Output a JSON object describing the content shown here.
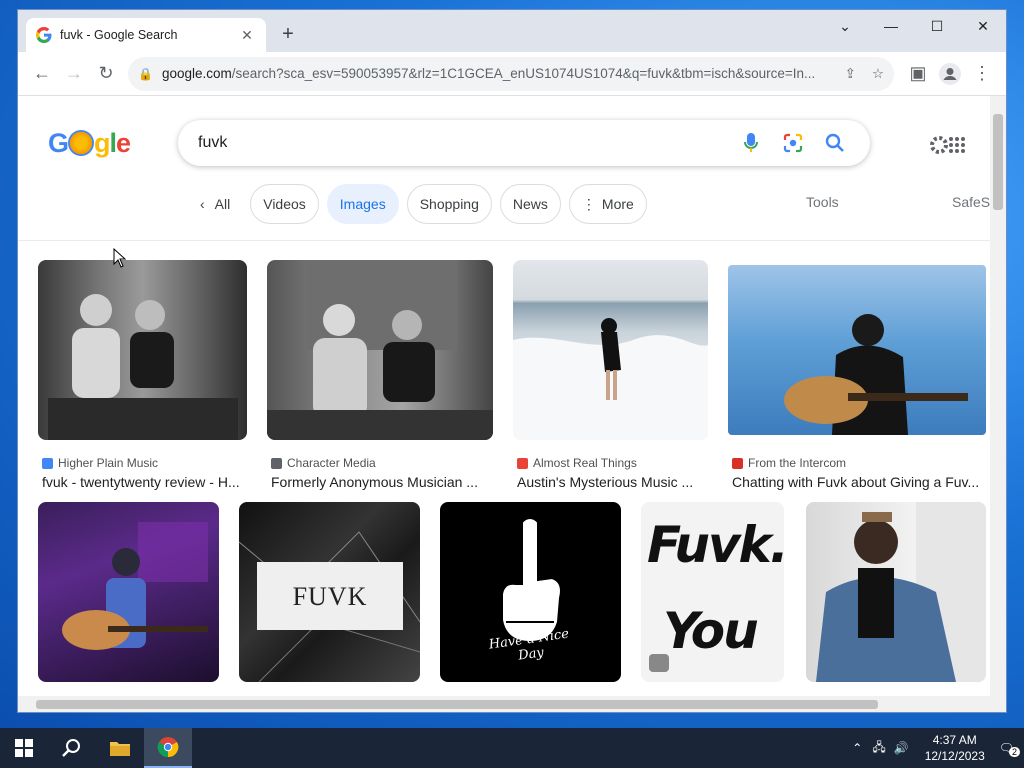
{
  "browser": {
    "tab_title": "fuvk - Google Search",
    "url_main": "google.com",
    "url_rest": "/search?sca_esv=590053957&rlz=1C1GCEA_enUS1074US1074&q=fuvk&tbm=isch&source=In..."
  },
  "search": {
    "query": "fuvk",
    "chips": [
      "All",
      "Videos",
      "Images",
      "Shopping",
      "News",
      "More"
    ],
    "active_chip": "Images",
    "tools": "Tools",
    "safesearch": "SafeS"
  },
  "results": [
    {
      "source": "Higher Plain Music",
      "title": "fvuk - twentytwenty review - H...",
      "src_color": "#4285f4"
    },
    {
      "source": "Character Media",
      "title": "Formerly Anonymous Musician ...",
      "src_color": "#5f6368"
    },
    {
      "source": "Almost Real Things",
      "title": "Austin's Mysterious Music ...",
      "src_color": "#ea4335"
    },
    {
      "source": "From the Intercom",
      "title": "Chatting with Fuvk about Giving a Fuv...",
      "src_color": "#d93025"
    }
  ],
  "row2": [
    {
      "image_text": ""
    },
    {
      "image_text": "FUVK"
    },
    {
      "image_text": "Have a Nice Day"
    },
    {
      "image_text_1": "Fuvk.",
      "image_text_2": "You"
    },
    {
      "image_text": ""
    }
  ],
  "taskbar": {
    "time": "4:37 AM",
    "date": "12/12/2023"
  }
}
